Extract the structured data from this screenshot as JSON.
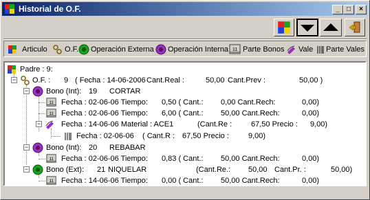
{
  "window": {
    "title": "Historial de O.F."
  },
  "legend": [
    {
      "label": "Articulo",
      "icon": "articulo-icon"
    },
    {
      "label": "O.F.",
      "icon": "of-icon"
    },
    {
      "label": "Operación Externa",
      "icon": "operacion-externa-icon"
    },
    {
      "label": "Operación Interna",
      "icon": "operacion-interna-icon"
    },
    {
      "label": "Parte Bonos",
      "icon": "parte-bonos-icon"
    },
    {
      "label": "Vale",
      "icon": "vale-icon"
    },
    {
      "label": "Parte Vales",
      "icon": "parte-vales-icon"
    }
  ],
  "tree": {
    "root": "Padre : 9:",
    "of": [
      "O.F. :",
      "9",
      "( Fecha : 14-06-2006",
      "Cant.Real :",
      "50,00",
      "Cant.Prev :",
      "50,00 )"
    ],
    "bono1": [
      "Bono (Int):",
      "19",
      "CORTAR"
    ],
    "b1p1": [
      "Fecha : 02-06-06 Tiempo:",
      "0,50 ( Cant.:",
      "0,00 Cant.Rech:",
      "0,00)"
    ],
    "b1p2": [
      "Fecha : 02-06-06 Tiempo:",
      "6,00 ( Cant.:",
      "50,00 Cant.Rech:",
      "0,00)"
    ],
    "vale": [
      "Fecha : 14-06-06 Material : ACE1",
      "(Cant.Re :",
      "67,50 Precio :",
      "9,00)"
    ],
    "pvale": [
      "Fecha : 02-06-06",
      "( Cant.R :",
      "67,50 Precio :",
      "9,00)"
    ],
    "bono2": [
      "Bono (Int):",
      "20",
      "REBABAR"
    ],
    "b2p1": [
      "Fecha : 02-06-06 Tiempo:",
      "0,83 ( Cant.:",
      "50,00 Cant.Rech:",
      "0,00)"
    ],
    "bono3": [
      "Bono (Ext):",
      "21",
      "NIQUELAR",
      "(Cant.Re.:",
      "50,00",
      "Cant.Pr. :",
      "50,00)"
    ],
    "b3p1": [
      "Fecha : 14-06-06 Tiempo:",
      "0,00 ( Cant.:",
      "50,00 Cant.Rech:",
      "0,00)"
    ]
  },
  "colors": {
    "titlebar_start": "#0a246a",
    "titlebar_end": "#a6caf0",
    "op_interna": "#9b2fbf",
    "op_externa": "#1aa01a"
  }
}
